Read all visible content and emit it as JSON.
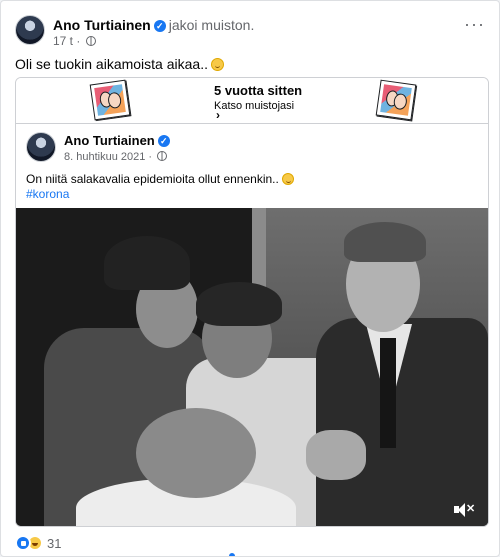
{
  "post": {
    "author": "Ano Turtiainen",
    "action": "jakoi muiston.",
    "time": "17 t",
    "separator": "·",
    "text": "Oli se tuokin aikamoista aikaa..",
    "more_menu": "···"
  },
  "memory": {
    "title": "5 vuotta sitten",
    "link": "Katso muistojasi",
    "chevron": "›"
  },
  "inner_post": {
    "author": "Ano Turtiainen",
    "date": "8. huhtikuu 2021",
    "separator": "·",
    "text": "On niitä salakavalia epidemioita ollut ennenkin..",
    "hashtag": "#korona"
  },
  "video": {
    "mute_icon": "speaker-muted-icon"
  },
  "reactions": {
    "count": "31",
    "types": [
      "like-icon",
      "haha-icon"
    ]
  },
  "colors": {
    "brand": "#1877f2",
    "secondary_text": "#65676b"
  }
}
